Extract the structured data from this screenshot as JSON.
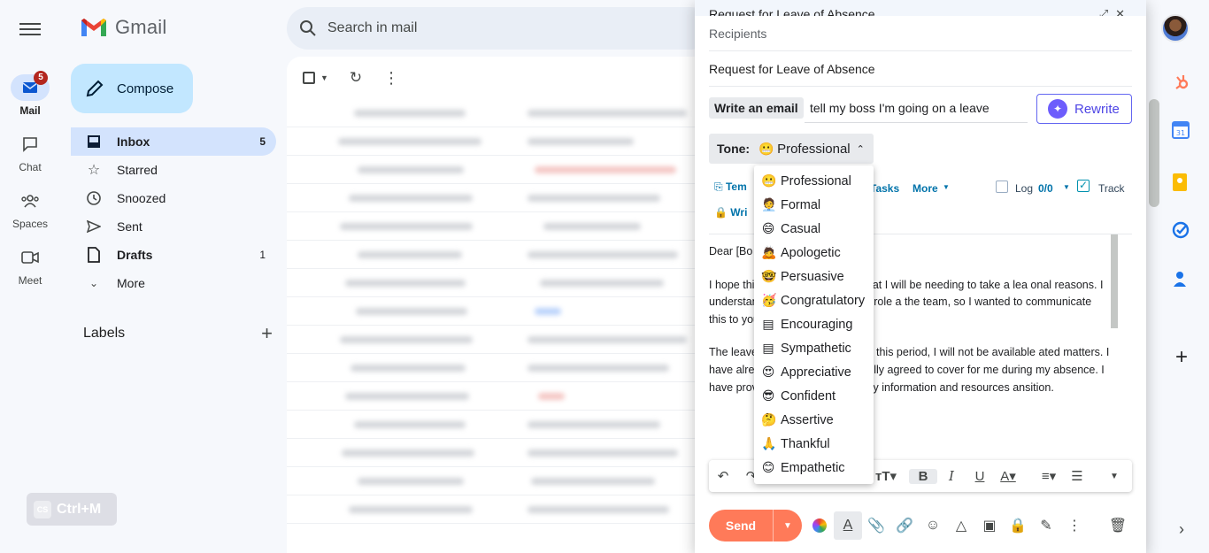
{
  "app": {
    "name": "Gmail"
  },
  "rail": [
    {
      "label": "Mail",
      "badge": "5"
    },
    {
      "label": "Chat"
    },
    {
      "label": "Spaces"
    },
    {
      "label": "Meet"
    }
  ],
  "compose_label": "Compose",
  "nav": [
    {
      "label": "Inbox",
      "count": "5"
    },
    {
      "label": "Starred",
      "count": ""
    },
    {
      "label": "Snoozed",
      "count": ""
    },
    {
      "label": "Sent",
      "count": ""
    },
    {
      "label": "Drafts",
      "count": "1"
    },
    {
      "label": "More",
      "count": ""
    }
  ],
  "labels_heading": "Labels",
  "search": {
    "placeholder": "Search in mail"
  },
  "composer": {
    "title": "Request for Leave of Absence",
    "recipients_placeholder": "Recipients",
    "subject": "Request for Leave of Absence",
    "write_label": "Write an email",
    "prompt": "tell my boss I'm going on a leave",
    "rewrite_label": "Rewrite",
    "tone_label": "Tone:",
    "tone_value": "Professional",
    "hubspot": {
      "templates": "Tem",
      "tasks": "Tasks",
      "more": "More",
      "log": "Log",
      "log_count": "0/0",
      "track": "Track",
      "write": "Wri"
    },
    "body": [
      "Dear [Bo",
      "I hope thi                wanted to inform you that I will be needing to take a lea                onal reasons. I understand the importance of my role a                the team, so I wanted to communicate this to you in a t",
      "The leave                e] to [end date]. During this period, I will not be available                ated matters. I have already spoken to [colleagu                lly agreed to cover for me during my absence. I have prov                e] with all the necessary information and resources                ansition."
    ],
    "send_label": "Send"
  },
  "tone_options": [
    {
      "emoji": "😬",
      "label": "Professional"
    },
    {
      "emoji": "🧑‍💼",
      "label": "Formal"
    },
    {
      "emoji": "😄",
      "label": "Casual"
    },
    {
      "emoji": "🙇",
      "label": "Apologetic"
    },
    {
      "emoji": "🤓",
      "label": "Persuasive"
    },
    {
      "emoji": "🥳",
      "label": "Congratulatory"
    },
    {
      "emoji": "▤",
      "label": "Encouraging"
    },
    {
      "emoji": "▤",
      "label": "Sympathetic"
    },
    {
      "emoji": "😍",
      "label": "Appreciative"
    },
    {
      "emoji": "😎",
      "label": "Confident"
    },
    {
      "emoji": "🤔",
      "label": "Assertive"
    },
    {
      "emoji": "🙏",
      "label": "Thankful"
    },
    {
      "emoji": "😊",
      "label": "Empathetic"
    }
  ],
  "shortcut_label": "Ctrl+M",
  "shortcut_icon_text": "CS"
}
